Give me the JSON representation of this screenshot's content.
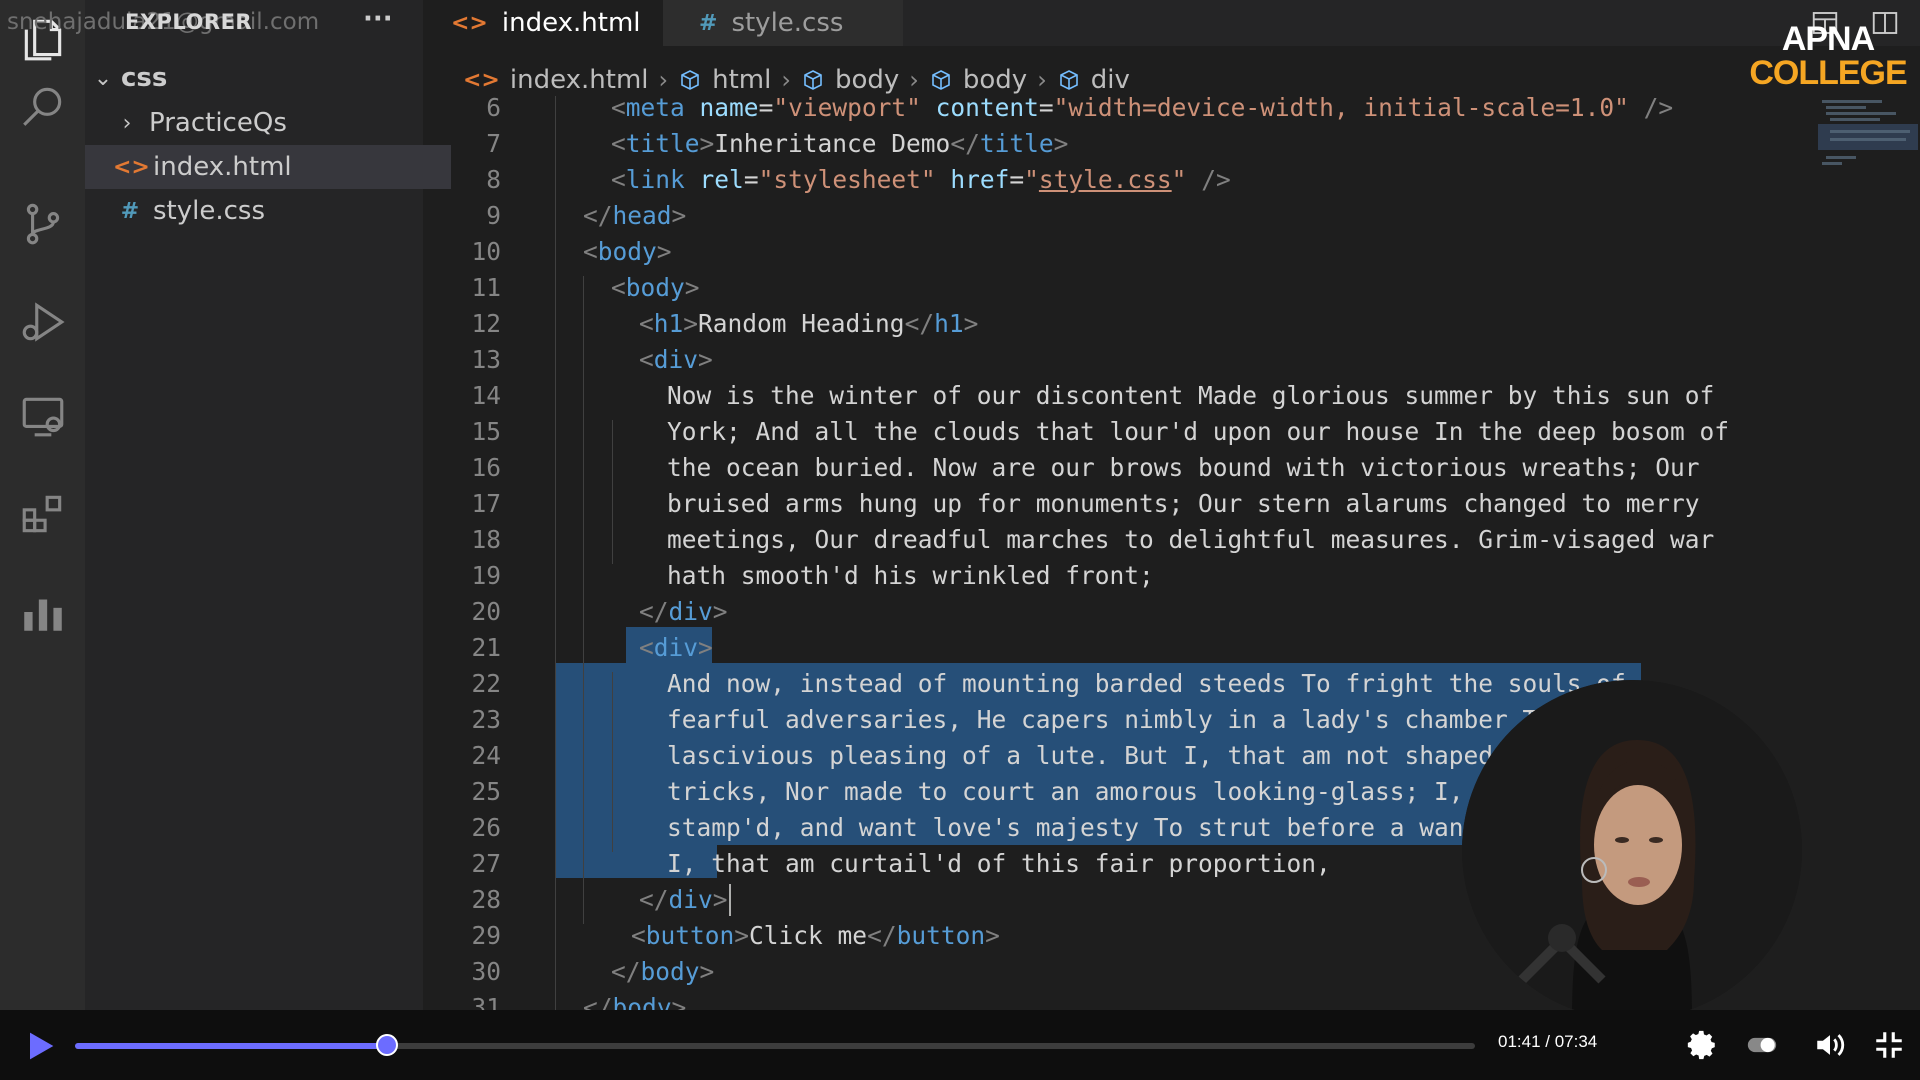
{
  "sidebar": {
    "email": "snehajadula21@gmail.com",
    "title": "EXPLORER",
    "more": "···",
    "folder": "css",
    "items": [
      {
        "label": "PracticeQs",
        "type": "folder"
      },
      {
        "label": "index.html",
        "type": "html",
        "icon": "<>"
      },
      {
        "label": "style.css",
        "type": "css",
        "icon": "#"
      }
    ]
  },
  "tabs": [
    {
      "label": "index.html",
      "icon": "<>",
      "close": "✕"
    },
    {
      "label": "style.css",
      "icon": "#"
    }
  ],
  "breadcrumbs": [
    "index.html",
    "html",
    "body",
    "body",
    "div"
  ],
  "logo": {
    "top": "APNA",
    "bottom": "COLLEGE"
  },
  "editor": {
    "line_numbers": [
      "6",
      "7",
      "8",
      "9",
      "10",
      "11",
      "12",
      "13",
      "14",
      "15",
      "16",
      "17",
      "18",
      "19",
      "20",
      "21",
      "22",
      "23",
      "24",
      "25",
      "26",
      "27",
      "28",
      "29",
      "30",
      "31"
    ],
    "meta_tag": "meta",
    "meta_name_attr": "name",
    "meta_name_val": "\"viewport\"",
    "meta_content_attr": "content",
    "meta_content_val": "\"width=device-width, initial-scale=1.0\"",
    "title_tag": "title",
    "title_text": "Inheritance Demo",
    "link_tag": "link",
    "link_rel_attr": "rel",
    "link_rel_val": "\"stylesheet\"",
    "link_href_attr": "href",
    "link_href_val": "style.css",
    "head_tag": "head",
    "body_tag": "body",
    "h1_tag": "h1",
    "h1_text": "Random Heading",
    "div_tag": "div",
    "button_tag": "button",
    "button_text": "Click me",
    "div1_text": [
      "Now is the winter of our discontent Made glorious summer by this sun of",
      "York; And all the clouds that lour'd upon our house In the deep bosom of",
      "the ocean buried. Now are our brows bound with victorious wreaths; Our",
      "bruised arms hung up for monuments; Our stern alarums changed to merry",
      "meetings, Our dreadful marches to delightful measures. Grim-visaged war",
      "hath smooth'd his wrinkled front;"
    ],
    "div2_text": [
      "And now, instead of mounting barded steeds To fright the souls of",
      "fearful adversaries, He capers nimbly in a lady's chamber To the",
      "lascivious pleasing of a lute. But I, that am not shaped for",
      "tricks, Nor made to court an amorous looking-glass; I, that",
      "stamp'd, and want love's majesty To strut before a wanton",
      "I, that am curtail'd of this fair proportion,"
    ]
  },
  "player": {
    "time": "01:41 / 07:34",
    "progress": 0.2226,
    "accent": "#6c6cff"
  },
  "colors": {
    "tag": "#569cd6",
    "attr": "#9cdcfe",
    "string": "#ce9178",
    "selection": "#264f78",
    "logo_accent": "#f5a623"
  }
}
